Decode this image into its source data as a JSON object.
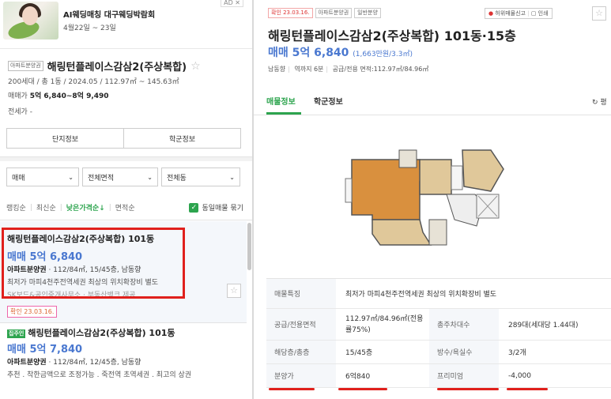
{
  "ad": {
    "title": "AI웨딩매칭 대구웨딩박람회",
    "date": "4월22일 ~ 23일",
    "badge": "AD ✕"
  },
  "complex": {
    "type_tag": "아파트분양권",
    "name": "해링턴플레이스감삼2(주상복합)",
    "info": "200세대 / 총 1동 / 2024.05 / 112.97㎡ ~ 145.63㎡",
    "price_label": "매매가",
    "price_value": "5억 6,840~8억 9,490",
    "rent": "전세가 -",
    "buttons": [
      "단지정보",
      "학군정보"
    ]
  },
  "filters": {
    "trade": "매매",
    "area": "전체면적",
    "dong": "전체동"
  },
  "sorts": {
    "ranking": "랭킹순",
    "latest": "최신순",
    "low_price": "낮은가격순↓",
    "area": "면적순",
    "group_same": "동일매물 묶기"
  },
  "listing1": {
    "title": "해링턴플레이스감삼2(주상복합) 101동",
    "price": "매매 5억 6,840",
    "spec_type": "아파트분양권",
    "spec_rest": " · 112/84㎡, 15/45층, 남동향",
    "desc": "최저가 마피4천주전역세권 최상의 위치확장비 별도",
    "faded": "SK보드&공인중개사무소 · 부동산뱅크 제공",
    "confirm": "확인 23.03.16."
  },
  "listing2": {
    "badge": "집주인",
    "title": "해링턴플레이스감삼2(주상복합) 101동",
    "price": "매매 5억 7,840",
    "spec_type": "아파트분양권",
    "spec_rest": " · 112/84㎡, 12/45층, 남동향",
    "desc": "추천 . 착한금액으로 조정가능 . 죽전역 초역세권 . 최고의 상권"
  },
  "detail": {
    "tags": [
      "확인 23.03.16.",
      "아파트분양권",
      "일반분양"
    ],
    "report": "허위매물신고",
    "print": "인쇄",
    "title": "해링턴플레이스감삼2(주상복합) 101동·15층",
    "price": "매매 5억 6,840",
    "price_sub": "(1,663만원/3.3㎡)",
    "meta1": "남동향",
    "meta2": "역까지 6분",
    "meta3": "공급/전용 면적:112.97㎡/84.96㎡",
    "tab_info": "매물정보",
    "tab_school": "학군정보",
    "refresh": "평"
  },
  "table": {
    "feature_label": "매물특징",
    "feature_value": "최저가 마피4천주전역세권 최상의 위치확장비 별도",
    "area_label": "공급/전용면적",
    "area_value": "112.97㎡/84.96㎡(전용률75%)",
    "parking_label": "총주차대수",
    "parking_value": "289대(세대당 1.44대)",
    "floor_label": "해당층/총층",
    "floor_value": "15/45층",
    "rooms_label": "방수/욕실수",
    "rooms_value": "3/2개",
    "sale_label": "분양가",
    "sale_value": "6억840",
    "premium_label": "프리미엄",
    "premium_value": "-4,000"
  },
  "colors": {
    "accent_green": "#2da44e",
    "price_blue": "#4a78d0",
    "highlight_red": "#e0201c"
  }
}
